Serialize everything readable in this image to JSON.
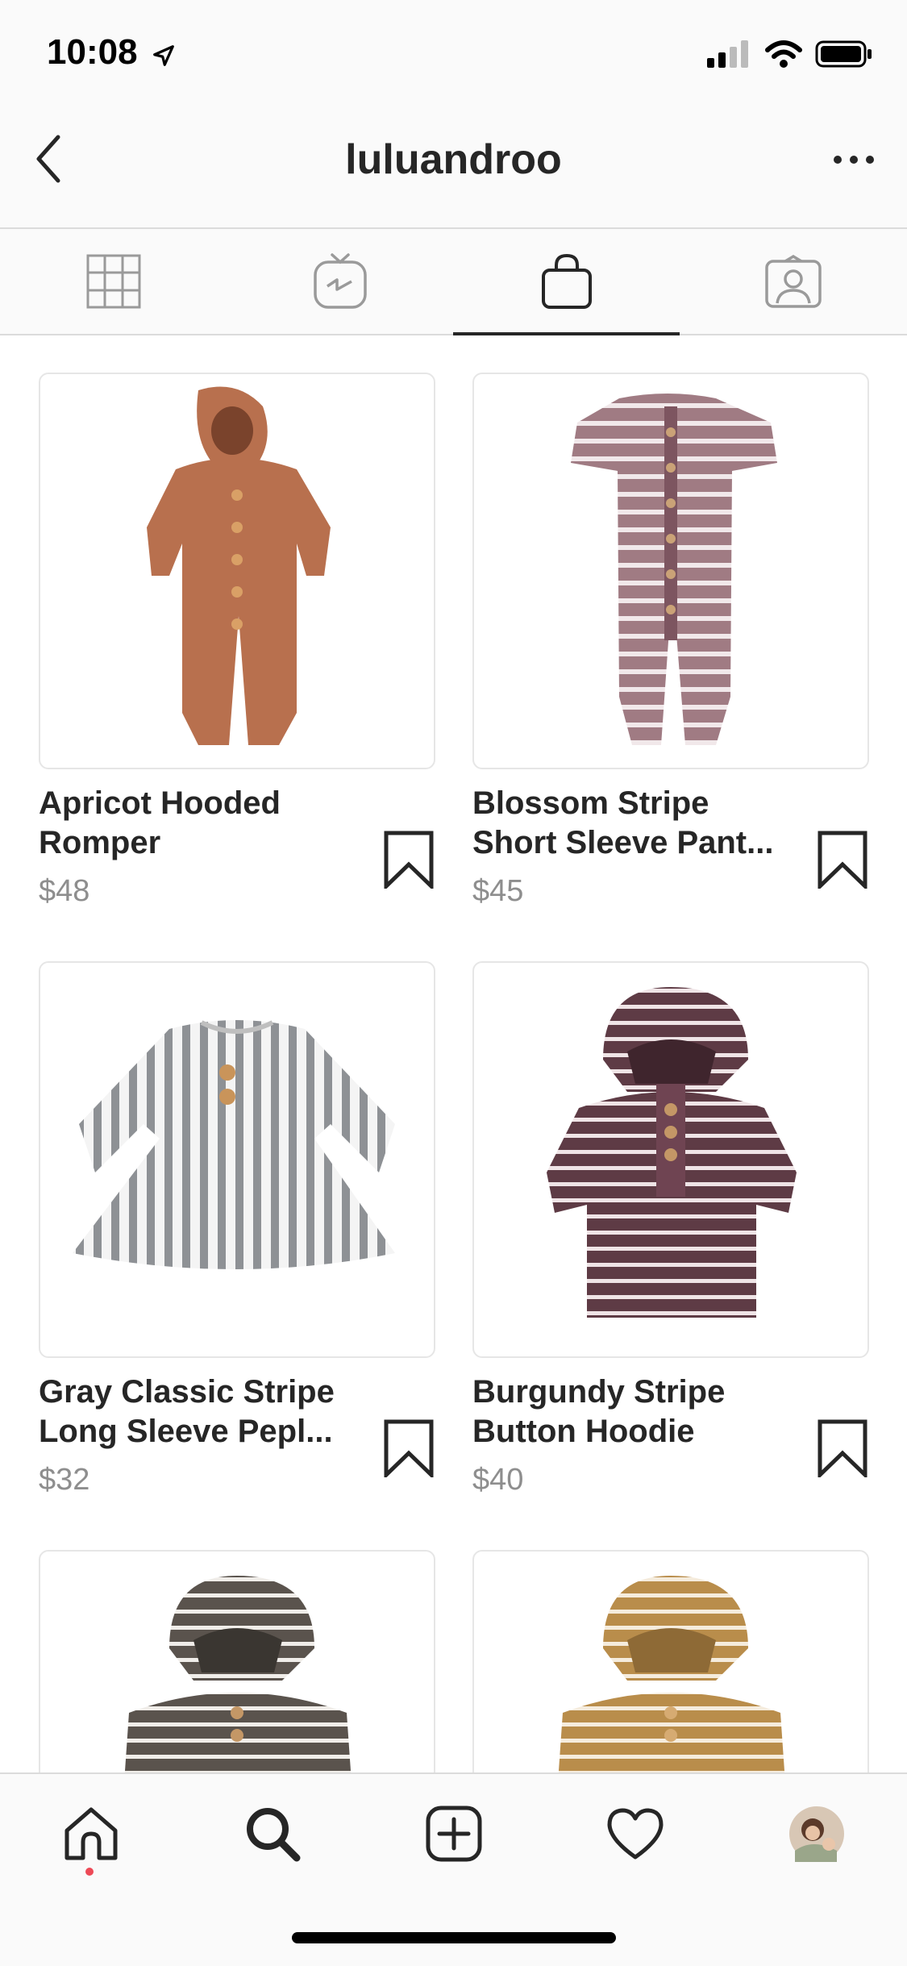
{
  "status_bar": {
    "time": "10:08"
  },
  "header": {
    "title": "luluandroo"
  },
  "tabs": [
    {
      "name": "grid",
      "active": false
    },
    {
      "name": "igtv",
      "active": false
    },
    {
      "name": "shop",
      "active": true
    },
    {
      "name": "tagged",
      "active": false
    }
  ],
  "products": [
    {
      "title": "Apricot Hooded\nRomper",
      "price": "$48",
      "color": "#b8704e"
    },
    {
      "title": "Blossom Stripe\nShort Sleeve Pant...",
      "price": "$45",
      "color": "#a07b83"
    },
    {
      "title": "Gray Classic Stripe\nLong Sleeve Pepl...",
      "price": "$32",
      "color": "#8e9195"
    },
    {
      "title": "Burgundy Stripe\nButton Hoodie",
      "price": "$40",
      "color": "#5e3b45"
    },
    {
      "title": "",
      "price": "",
      "color": "#5a534d"
    },
    {
      "title": "",
      "price": "",
      "color": "#b98d4b"
    }
  ],
  "colors": {
    "accent": "#262626",
    "muted": "#8e8e8e",
    "notification": "#ed4956"
  }
}
